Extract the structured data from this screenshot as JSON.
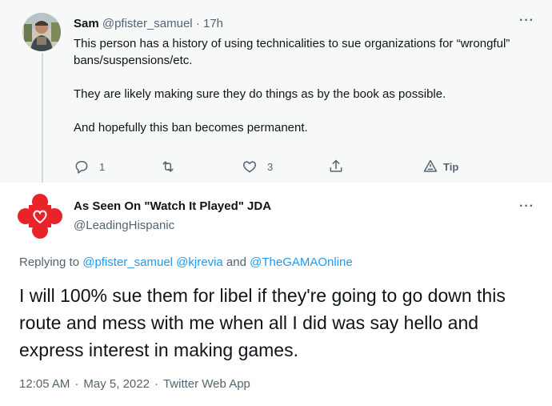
{
  "top_tweet": {
    "name": "Sam",
    "handle": "@pfister_samuel",
    "dot": "·",
    "time": "17h",
    "paragraphs": [
      "This person has a history of using technicalities to sue organizations for “wrongful” bans/suspensions/etc.",
      "They are likely making sure they do things as by the book as possible.",
      "And hopefully this ban becomes permanent."
    ],
    "more": "···",
    "actions": {
      "reply_count": "1",
      "like_count": "3",
      "tip_label": "Tip"
    },
    "icons": [
      "reply-icon",
      "retweet-icon",
      "like-icon",
      "share-icon",
      "tip-icon"
    ]
  },
  "main_tweet": {
    "name": "As Seen On \"Watch It Played\" JDA",
    "handle": "@LeadingHispanic",
    "more": "···",
    "replying_prefix": "Replying to",
    "replying_to": [
      "@pfister_samuel",
      "@kjrevia",
      "@TheGAMAOnline"
    ],
    "replying_and": "and",
    "text": "I will 100% sue them for libel if they're going to go down this route and mess with me when all I did was say hello and express interest in making games.",
    "time": "12:05 AM",
    "date": "May 5, 2022",
    "source": "Twitter Web App",
    "sep": "·"
  },
  "colors": {
    "link": "#1d9bf0",
    "muted": "#536471",
    "text": "#0f1419",
    "top_bg": "#f7f9f9",
    "avatar_red": "#e8232a"
  }
}
